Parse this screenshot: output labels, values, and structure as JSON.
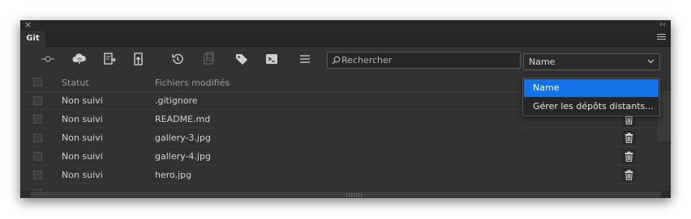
{
  "window": {
    "close_glyph": "×",
    "collapse_glyph": "‹‹"
  },
  "tab": {
    "label": "Git"
  },
  "toolbar": {
    "buttons": [
      {
        "name": "commit-icon"
      },
      {
        "name": "push-icon"
      },
      {
        "name": "fetch-icon"
      },
      {
        "name": "pull-icon"
      },
      {
        "name": "history-icon"
      },
      {
        "name": "stash-icon"
      },
      {
        "name": "tag-icon"
      },
      {
        "name": "terminal-icon"
      },
      {
        "name": "list-icon"
      }
    ]
  },
  "search": {
    "placeholder": "Rechercher",
    "value": ""
  },
  "remote_select": {
    "value": "Name"
  },
  "remote_dropdown": {
    "options": [
      "Name",
      "Gérer les dépôts distants..."
    ],
    "selected_index": 0
  },
  "table": {
    "headers": {
      "status": "Statut",
      "files": "Fichiers modifiés"
    },
    "rows": [
      {
        "status": "Non suivi",
        "file": ".gitignore"
      },
      {
        "status": "Non suivi",
        "file": "README.md"
      },
      {
        "status": "Non suivi",
        "file": "gallery-3.jpg"
      },
      {
        "status": "Non suivi",
        "file": "gallery-4.jpg"
      },
      {
        "status": "Non suivi",
        "file": "hero.jpg"
      }
    ]
  },
  "colors": {
    "panel_bg": "#323232",
    "selection_blue": "#1473e6",
    "text": "#d2d2d2"
  }
}
